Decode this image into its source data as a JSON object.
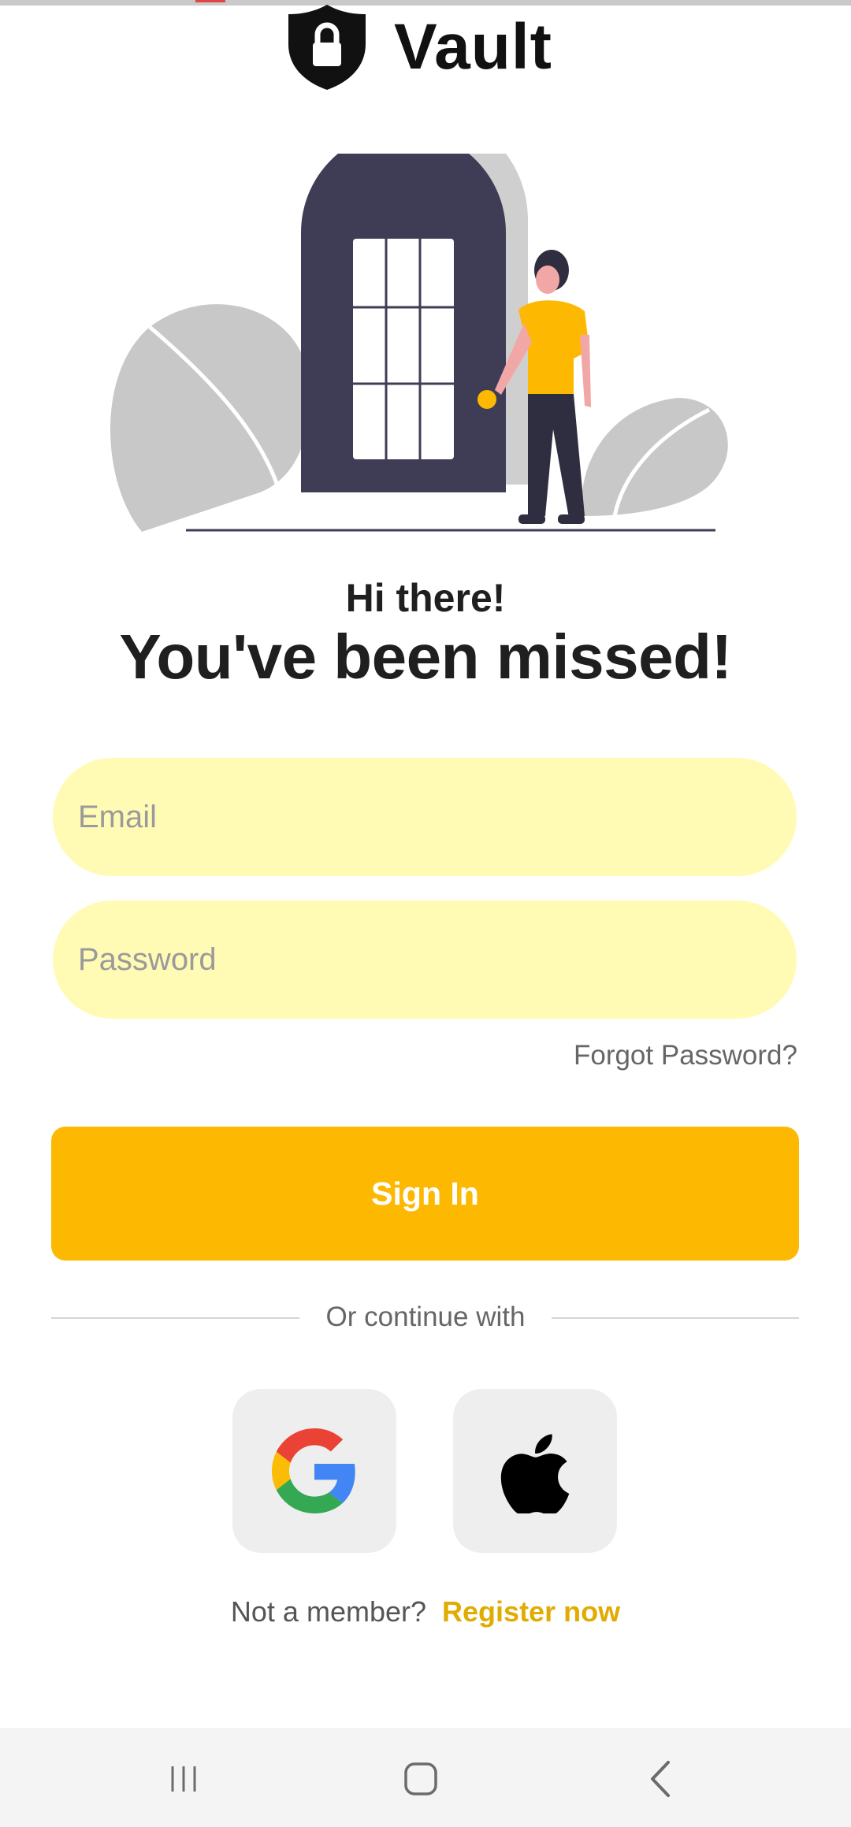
{
  "app": {
    "title": "Vault"
  },
  "greeting": {
    "line1": "Hi there!",
    "line2": "You've been missed!"
  },
  "form": {
    "email_placeholder": "Email",
    "email_value": "",
    "password_placeholder": "Password",
    "password_value": "",
    "forgot_label": "Forgot Password?",
    "signin_label": "Sign In"
  },
  "social": {
    "divider_label": "Or continue with",
    "providers": [
      {
        "name": "google-icon"
      },
      {
        "name": "apple-icon"
      }
    ]
  },
  "register": {
    "prompt": "Not a member?",
    "link_label": "Register now"
  },
  "nav": {
    "icons": [
      "recent-apps-icon",
      "home-icon",
      "back-icon"
    ]
  },
  "colors": {
    "accent": "#fdb902",
    "field_bg": "#fffbb4",
    "link": "#e0ac02",
    "dark": "#3f3d56"
  }
}
